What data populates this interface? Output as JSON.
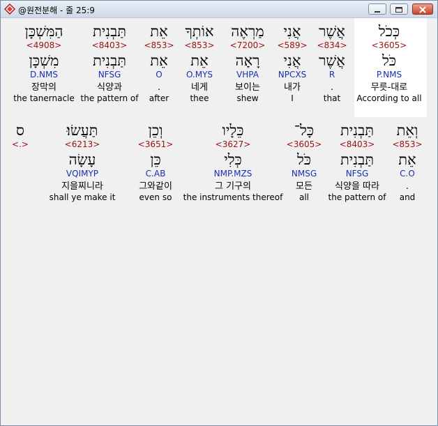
{
  "window": {
    "title": "@원전분해 - 줄 25:9",
    "icon": "app-diamond-icon"
  },
  "row1": [
    {
      "heb": "הַמִּשְׁכָּן",
      "strong": "<4908>",
      "lemma": "מִשְׁכָּן",
      "morph": "D.NMS",
      "kor": "장막의",
      "eng": "the tanernacle"
    },
    {
      "heb": "תַּבְנִית",
      "strong": "<8403>",
      "lemma": "תַּבְנִית",
      "morph": "NFSG",
      "kor": "식양과",
      "eng": "the pattern of"
    },
    {
      "heb": "אֵת",
      "strong": "<853>",
      "lemma": "אֵת",
      "morph": "O",
      "kor": ".",
      "eng": "after"
    },
    {
      "heb": "אוֹתְךָ",
      "strong": "<853>",
      "lemma": "אֵת",
      "morph": "O.MYS",
      "kor": "네게",
      "eng": "thee"
    },
    {
      "heb": "מַרְאֶה",
      "strong": "<7200>",
      "lemma": "רָאָה",
      "morph": "VHPA",
      "kor": "보이는",
      "eng": "shew"
    },
    {
      "heb": "אֲנִי",
      "strong": "<589>",
      "lemma": "אֲנִי",
      "morph": "NPCXS",
      "kor": "내가",
      "eng": "I"
    },
    {
      "heb": "אֲשֶׁר",
      "strong": "<834>",
      "lemma": "אֲשֶׁר",
      "morph": "R",
      "kor": ".",
      "eng": "that"
    },
    {
      "heb": "כְּכֹל",
      "strong": "<3605>",
      "lemma": "כֹּל",
      "morph": "P.NMS",
      "kor": "무릇-대로",
      "eng": "According to all"
    }
  ],
  "row2": [
    {
      "heb": "ס",
      "strong": "<.>",
      "lemma": "",
      "morph": "",
      "kor": "",
      "eng": ""
    },
    {
      "heb": "תַּעֲשׂוּ׃",
      "strong": "<6213>",
      "lemma": "עָשָׂה",
      "morph": "VQIMYP",
      "kor": "지을찌니라",
      "eng": "shall ye make it"
    },
    {
      "heb": "וְכֵן",
      "strong": "<3651>",
      "lemma": "כֵּן",
      "morph": "C.AB",
      "kor": "그와같이",
      "eng": "even so"
    },
    {
      "heb": "כֵּלָיו",
      "strong": "<3627>",
      "lemma": "כְּלִי",
      "morph": "NMP.MZS",
      "kor": "그 기구의",
      "eng": "the instruments thereof"
    },
    {
      "heb": "כָּל־",
      "strong": "<3605>",
      "lemma": "כֹּל",
      "morph": "NMSG",
      "kor": "모든",
      "eng": "all"
    },
    {
      "heb": "תַּבְנִית",
      "strong": "<8403>",
      "lemma": "תַּבְנִית",
      "morph": "NFSG",
      "kor": "식양을 따라",
      "eng": "the pattern of"
    },
    {
      "heb": "וְאֵת",
      "strong": "<853>",
      "lemma": "אֵת",
      "morph": "C.O",
      "kor": ".",
      "eng": "and"
    }
  ]
}
